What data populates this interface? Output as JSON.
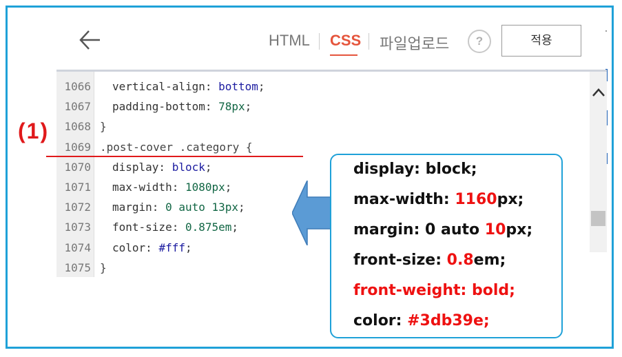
{
  "header": {
    "tabs": [
      {
        "label": "HTML"
      },
      {
        "label": "CSS"
      },
      {
        "label": "파일업로드"
      }
    ],
    "help_label": "?",
    "apply_label": "적용"
  },
  "editor": {
    "lines": [
      {
        "no": "1066",
        "prop": "vertical-align: ",
        "val": "bottom",
        "end": ";"
      },
      {
        "no": "1067",
        "prop": "padding-bottom: ",
        "val": "78px",
        "end": ";"
      },
      {
        "no": "1068",
        "text": "}"
      },
      {
        "no": "1069",
        "text": ".post-cover .category {"
      },
      {
        "no": "1070",
        "prop": "display: ",
        "val": "block",
        "end": ";"
      },
      {
        "no": "1071",
        "prop": "max-width: ",
        "val": "1080px",
        "end": ";"
      },
      {
        "no": "1072",
        "prop": "margin: ",
        "val": "0 auto 13px",
        "end": ";"
      },
      {
        "no": "1073",
        "prop": "font-size: ",
        "val": "0.875em",
        "end": ";"
      },
      {
        "no": "1074",
        "prop": "color: ",
        "val": "#fff",
        "end": ";"
      },
      {
        "no": "1075",
        "text": "}"
      }
    ]
  },
  "annotation": {
    "label": "(1)",
    "callout": [
      {
        "a": "display: block;",
        "b": "",
        "c": ""
      },
      {
        "a": "max-width: ",
        "b": "1160",
        "c": "px;"
      },
      {
        "a": "margin: 0 auto ",
        "b": "10",
        "c": "px;"
      },
      {
        "a": "front-size: ",
        "b": "0.8",
        "c": "em;"
      },
      {
        "a": "",
        "b": "front-weight: bold;",
        "c": ""
      },
      {
        "a": "color: ",
        "b": "#3db39e;",
        "c": ""
      }
    ]
  },
  "colors": {
    "accent": "#e5553c",
    "annotation_red": "#e0191b",
    "frame_blue": "#1fa1d8"
  }
}
